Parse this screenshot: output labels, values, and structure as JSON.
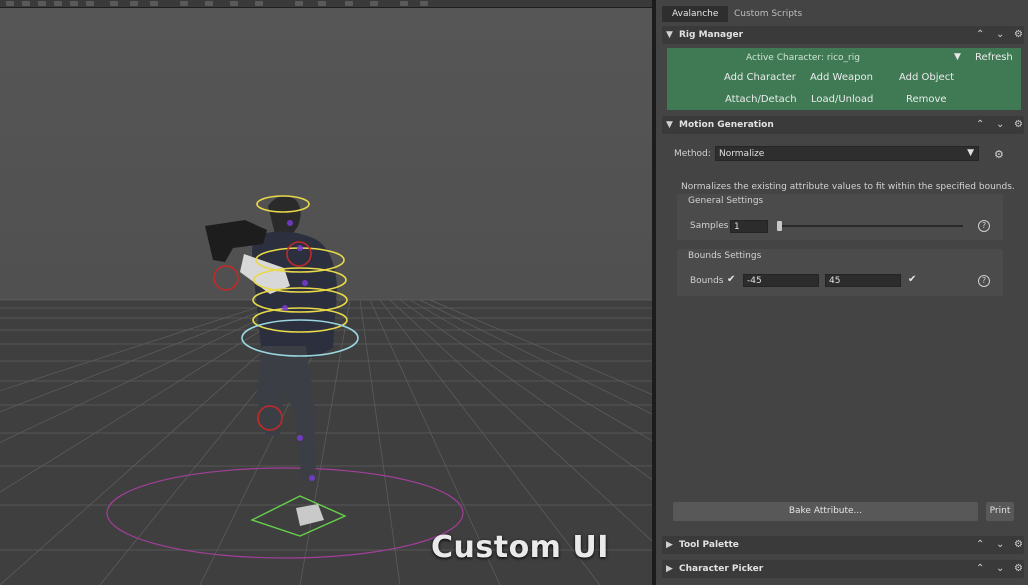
{
  "tabs": [
    {
      "label": "Avalanche",
      "active": true
    },
    {
      "label": "Custom Scripts",
      "active": false
    }
  ],
  "rig_manager": {
    "title": "Rig Manager",
    "active_character_label": "Active Character:",
    "active_character_value": "rico_rig",
    "refresh": "Refresh",
    "buttons": {
      "add_character": "Add Character",
      "add_weapon": "Add Weapon",
      "add_object": "Add Object",
      "attach_detach": "Attach/Detach",
      "load_unload": "Load/Unload",
      "remove": "Remove"
    },
    "accent_color": "#3f7a55"
  },
  "motion_generation": {
    "title": "Motion Generation",
    "method_label": "Method:",
    "method_value": "Normalize",
    "description": "Normalizes the existing attribute values to fit within the specified bounds.",
    "general_settings": {
      "title": "General Settings",
      "samples_label": "Samples",
      "samples_value": "1"
    },
    "bounds_settings": {
      "title": "Bounds Settings",
      "bounds_label": "Bounds",
      "min_value": "-45",
      "max_value": "45",
      "min_enabled": true,
      "max_enabled": true
    },
    "bake_button": "Bake Attribute...",
    "print_button": "Print"
  },
  "collapsed_sections": [
    {
      "title": "Tool Palette"
    },
    {
      "title": "Character Picker"
    }
  ],
  "viewport": {
    "caption": "Custom UI"
  },
  "icons": {
    "section_expanded": "▼",
    "section_collapsed": "▶",
    "move_up": "⌃",
    "move_down": "⌄",
    "settings": "⚙",
    "help": "?",
    "check": "✔"
  }
}
